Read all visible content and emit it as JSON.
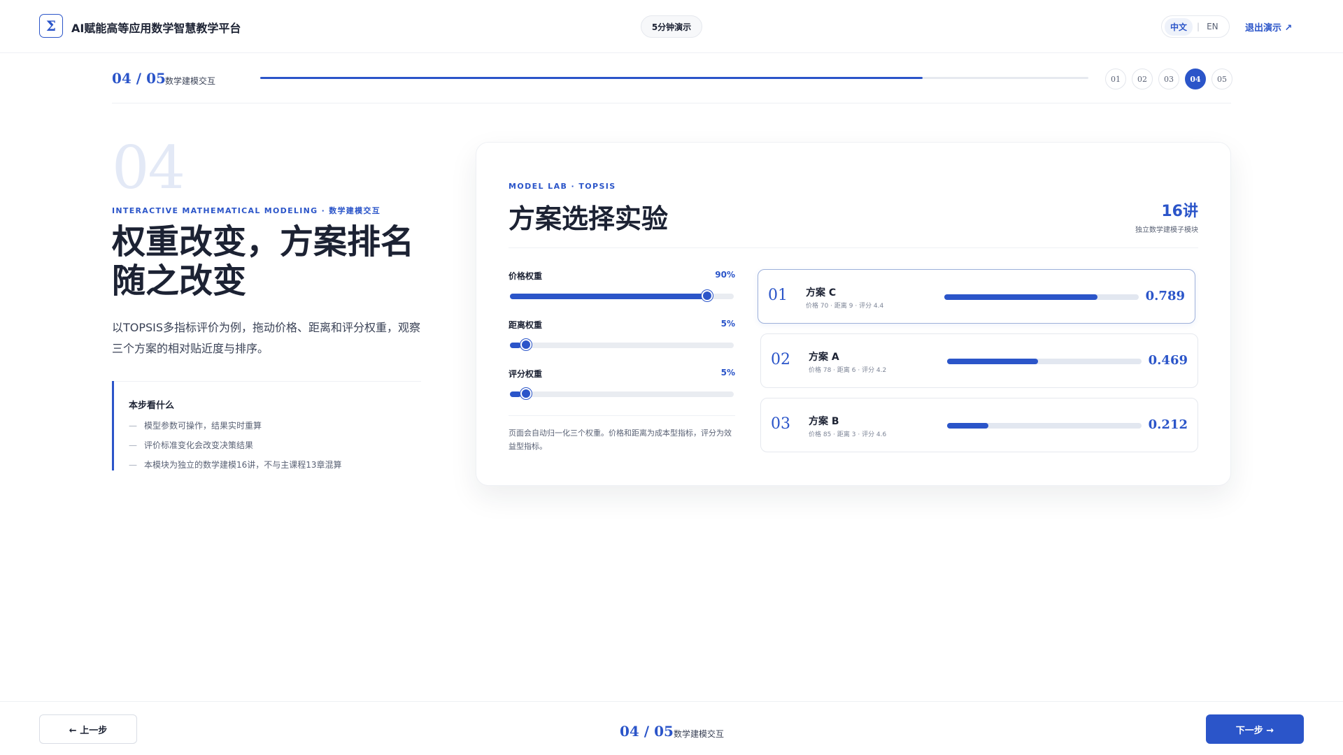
{
  "header": {
    "logo_glyph": "Σ",
    "app_title": "AI赋能高等应用数学智慧教学平台",
    "demo_label": "5分钟演示",
    "lang_active": "中文",
    "lang_separator": "|",
    "lang_other": "EN",
    "exit_label": "退出演示 ↗"
  },
  "steps": {
    "count_label": "04 / 05",
    "current_name": "数学建模交互",
    "progress": 0.8,
    "items": [
      "01",
      "02",
      "03",
      "04",
      "05"
    ],
    "active_index": 3
  },
  "intro": {
    "big_number": "04",
    "eyebrow": "INTERACTIVE MATHEMATICAL MODELING · 数学建模交互",
    "headline_lines": [
      "权重改变，方案排名",
      "随之改变"
    ],
    "description": "以TOPSIS多指标评价为例，拖动价格、距离和评分权重，观察三个方案的相对贴近度与排序。",
    "note_title": "本步看什么",
    "note_dash": "—",
    "note_items": [
      "模型参数可操作，结果实时重算",
      "评价标准变化会改变决策结果",
      "本模块为独立的数学建模16讲，不与主课程13章混算"
    ]
  },
  "lab": {
    "eyebrow": "MODEL LAB · TOPSIS",
    "title": "方案选择实验",
    "stat_value": "16讲",
    "stat_label": "独立数学建模子模块",
    "sliders": [
      {
        "label": "价格权重",
        "value_label": "90%",
        "value": 0.9
      },
      {
        "label": "距离权重",
        "value_label": "5%",
        "value": 0.05
      },
      {
        "label": "评分权重",
        "value_label": "5%",
        "value": 0.05
      }
    ],
    "footnote": "页面会自动归一化三个权重。价格和距离为成本型指标，评分为效益型指标。",
    "results": [
      {
        "rank": "01",
        "name": "方案 C",
        "meta": "价格 70 · 距离 9 · 评分 4.4",
        "score_label": "0.789",
        "score": 0.789
      },
      {
        "rank": "02",
        "name": "方案 A",
        "meta": "价格 78 · 距离 6 · 评分 4.2",
        "score_label": "0.469",
        "score": 0.469
      },
      {
        "rank": "03",
        "name": "方案 B",
        "meta": "价格 85 · 距离 3 · 评分 4.6",
        "score_label": "0.212",
        "score": 0.212
      }
    ]
  },
  "footer": {
    "prev_label": "← 上一步",
    "count_label": "04 / 05",
    "step_name": "数学建模交互",
    "next_label": "下一步 →"
  },
  "colors": {
    "accent": "#2b55c9",
    "text": "#1c2233",
    "muted": "#5a6275",
    "track": "#e9ecf1"
  }
}
